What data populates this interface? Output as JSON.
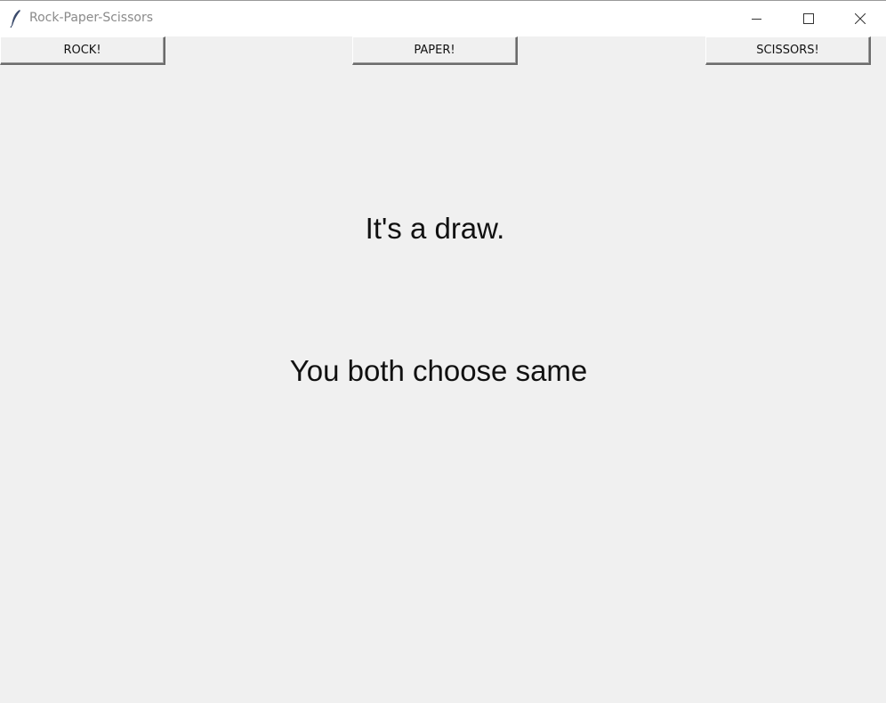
{
  "window": {
    "title": "Rock-Paper-Scissors",
    "icon": "feather-icon",
    "controls": [
      "minimize-icon",
      "maximize-icon",
      "close-icon"
    ]
  },
  "buttons": {
    "rock": "ROCK!",
    "paper": "PAPER!",
    "scissors": "SCISSORS!"
  },
  "result": {
    "headline": "It's a draw.",
    "detail": "You both choose same"
  },
  "colors": {
    "background": "#f0f0f0",
    "titlebar": "#ffffff",
    "text": "#111111"
  }
}
